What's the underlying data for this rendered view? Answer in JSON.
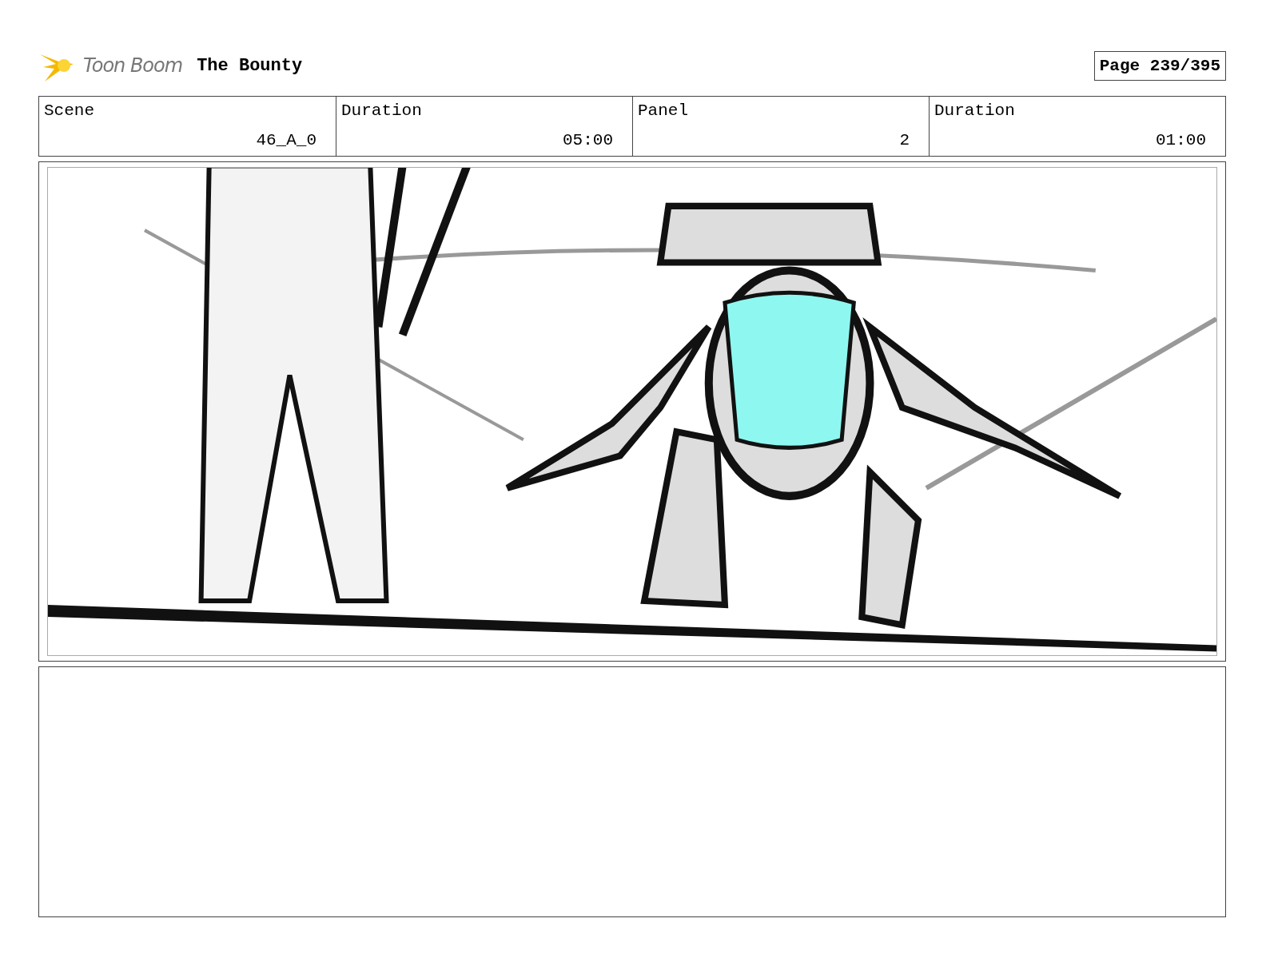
{
  "header": {
    "logo_text": "Toon Boom",
    "title": "The Bounty",
    "page": "Page 239/395"
  },
  "info": [
    {
      "label": "Scene",
      "value": "46_A_0"
    },
    {
      "label": "Duration",
      "value": "05:00"
    },
    {
      "label": "Panel",
      "value": "2"
    },
    {
      "label": "Duration",
      "value": "01:00"
    }
  ]
}
